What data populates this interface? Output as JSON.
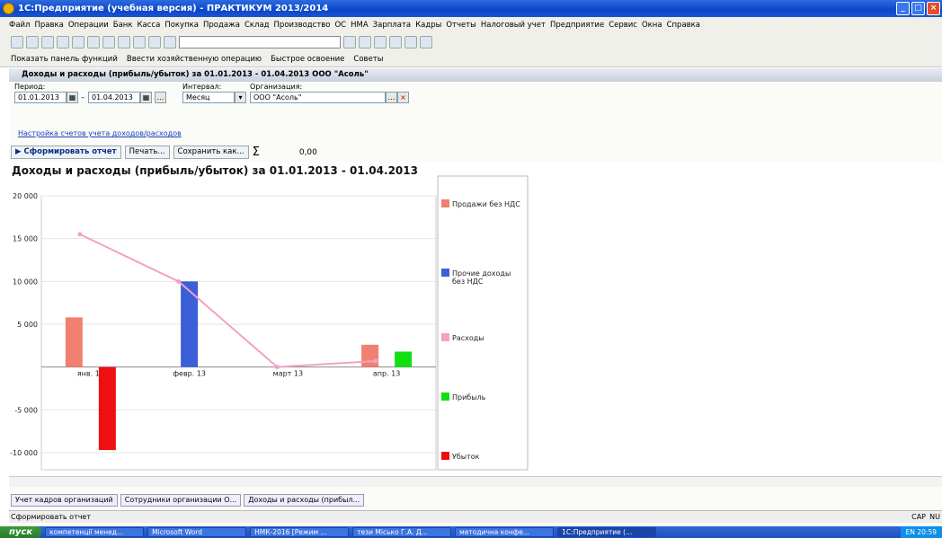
{
  "window": {
    "title": "1С:Предприятие (учебная версия) - ПРАКТИКУМ 2013/2014"
  },
  "menu": [
    "Файл",
    "Правка",
    "Операции",
    "Банк",
    "Касса",
    "Покупка",
    "Продажа",
    "Склад",
    "Производство",
    "ОС",
    "НМА",
    "Зарплата",
    "Кадры",
    "Отчеты",
    "Налоговый учет",
    "Предприятие",
    "Сервис",
    "Окна",
    "Справка"
  ],
  "toolbar2": {
    "panel": "Показать панель функций",
    "enter": "Ввести хозяйственную операцию",
    "learn": "Быстрое освоение",
    "tips": "Советы"
  },
  "doc": {
    "title": "Доходы и расходы (прибыль/убыток) за 01.01.2013 - 01.04.2013 ООО \"Асоль\""
  },
  "form": {
    "period_label": "Период:",
    "period_from": "01.01.2013",
    "period_to": "01.04.2013",
    "interval_label": "Интервал:",
    "interval_value": "Месяц",
    "org_label": "Организация:",
    "org_value": "ООО \"Асоль\"",
    "settings_link": "Настройка счетов учета доходов/расходов",
    "btn_generate": "Сформировать отчет",
    "btn_print": "Печать...",
    "btn_save": "Сохранить как...",
    "sum_value": "0,00"
  },
  "report": {
    "title": "Доходы и расходы (прибыль/убыток) за 01.01.2013 - 01.04.2013"
  },
  "chart_data": {
    "type": "bar",
    "categories": [
      "янв. 13",
      "февр. 13",
      "март 13",
      "апр. 13"
    ],
    "ylim": [
      -12000,
      20000
    ],
    "yticks": [
      20000,
      15000,
      10000,
      5000,
      0,
      -5000,
      -10000
    ],
    "ytick_labels": [
      "20 000",
      "15 000",
      "10 000",
      "5 000",
      "",
      "-5 000",
      "-10 000"
    ],
    "series": [
      {
        "name": "Продажи без НДС",
        "color": "#f08070",
        "values": [
          5800,
          0,
          0,
          2600
        ]
      },
      {
        "name": "Прочие доходы без НДС",
        "color": "#3a5fd8",
        "values": [
          0,
          10000,
          0,
          0
        ]
      },
      {
        "name": "Расходы",
        "color": "#f4a0c8",
        "kind": "line",
        "values": [
          15500,
          10000,
          0,
          700
        ]
      },
      {
        "name": "Прибыль",
        "color": "#10e010",
        "values": [
          0,
          0,
          0,
          1800
        ]
      },
      {
        "name": "Убыток",
        "color": "#ee1010",
        "values": [
          -9700,
          0,
          0,
          0
        ]
      }
    ],
    "legend": "right"
  },
  "tabs": [
    "Учет кадров организаций",
    "Сотрудники организации О...",
    "Доходы и расходы (прибыл..."
  ],
  "status": {
    "text": "Сформировать отчет",
    "caps": "CAP",
    "num": "NU"
  },
  "taskbar": {
    "start": "пуск",
    "items": [
      "компетенції менед...",
      "Microsoft Word",
      "НМК-2016 [Режим ...",
      "тези Місько Г.А. Д...",
      "методична конфе...",
      "1С:Предприятие (..."
    ],
    "lang": "EN",
    "clock": "20:59"
  }
}
